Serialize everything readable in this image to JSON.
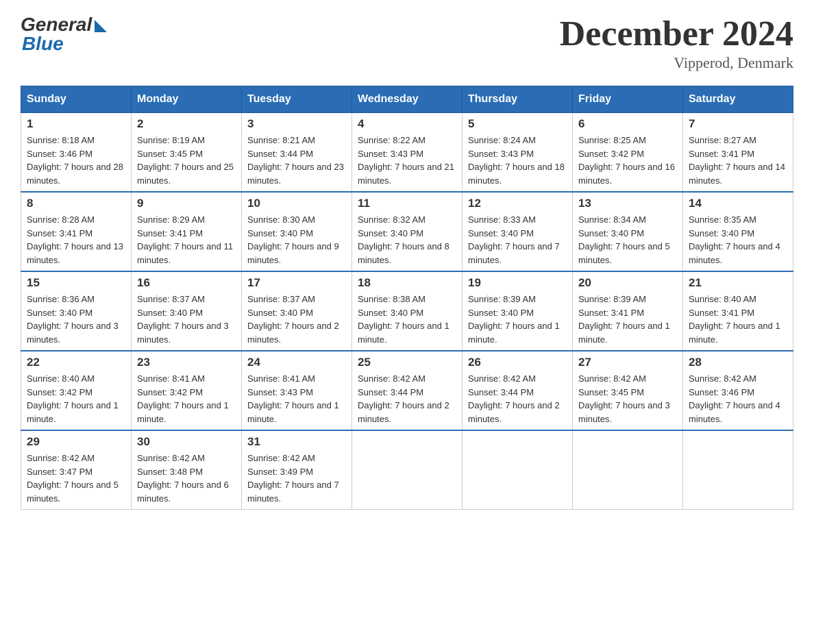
{
  "logo": {
    "general": "General",
    "blue": "Blue"
  },
  "title": "December 2024",
  "location": "Vipperod, Denmark",
  "days_of_week": [
    "Sunday",
    "Monday",
    "Tuesday",
    "Wednesday",
    "Thursday",
    "Friday",
    "Saturday"
  ],
  "weeks": [
    [
      {
        "day": "1",
        "sunrise": "8:18 AM",
        "sunset": "3:46 PM",
        "daylight": "7 hours and 28 minutes."
      },
      {
        "day": "2",
        "sunrise": "8:19 AM",
        "sunset": "3:45 PM",
        "daylight": "7 hours and 25 minutes."
      },
      {
        "day": "3",
        "sunrise": "8:21 AM",
        "sunset": "3:44 PM",
        "daylight": "7 hours and 23 minutes."
      },
      {
        "day": "4",
        "sunrise": "8:22 AM",
        "sunset": "3:43 PM",
        "daylight": "7 hours and 21 minutes."
      },
      {
        "day": "5",
        "sunrise": "8:24 AM",
        "sunset": "3:43 PM",
        "daylight": "7 hours and 18 minutes."
      },
      {
        "day": "6",
        "sunrise": "8:25 AM",
        "sunset": "3:42 PM",
        "daylight": "7 hours and 16 minutes."
      },
      {
        "day": "7",
        "sunrise": "8:27 AM",
        "sunset": "3:41 PM",
        "daylight": "7 hours and 14 minutes."
      }
    ],
    [
      {
        "day": "8",
        "sunrise": "8:28 AM",
        "sunset": "3:41 PM",
        "daylight": "7 hours and 13 minutes."
      },
      {
        "day": "9",
        "sunrise": "8:29 AM",
        "sunset": "3:41 PM",
        "daylight": "7 hours and 11 minutes."
      },
      {
        "day": "10",
        "sunrise": "8:30 AM",
        "sunset": "3:40 PM",
        "daylight": "7 hours and 9 minutes."
      },
      {
        "day": "11",
        "sunrise": "8:32 AM",
        "sunset": "3:40 PM",
        "daylight": "7 hours and 8 minutes."
      },
      {
        "day": "12",
        "sunrise": "8:33 AM",
        "sunset": "3:40 PM",
        "daylight": "7 hours and 7 minutes."
      },
      {
        "day": "13",
        "sunrise": "8:34 AM",
        "sunset": "3:40 PM",
        "daylight": "7 hours and 5 minutes."
      },
      {
        "day": "14",
        "sunrise": "8:35 AM",
        "sunset": "3:40 PM",
        "daylight": "7 hours and 4 minutes."
      }
    ],
    [
      {
        "day": "15",
        "sunrise": "8:36 AM",
        "sunset": "3:40 PM",
        "daylight": "7 hours and 3 minutes."
      },
      {
        "day": "16",
        "sunrise": "8:37 AM",
        "sunset": "3:40 PM",
        "daylight": "7 hours and 3 minutes."
      },
      {
        "day": "17",
        "sunrise": "8:37 AM",
        "sunset": "3:40 PM",
        "daylight": "7 hours and 2 minutes."
      },
      {
        "day": "18",
        "sunrise": "8:38 AM",
        "sunset": "3:40 PM",
        "daylight": "7 hours and 1 minute."
      },
      {
        "day": "19",
        "sunrise": "8:39 AM",
        "sunset": "3:40 PM",
        "daylight": "7 hours and 1 minute."
      },
      {
        "day": "20",
        "sunrise": "8:39 AM",
        "sunset": "3:41 PM",
        "daylight": "7 hours and 1 minute."
      },
      {
        "day": "21",
        "sunrise": "8:40 AM",
        "sunset": "3:41 PM",
        "daylight": "7 hours and 1 minute."
      }
    ],
    [
      {
        "day": "22",
        "sunrise": "8:40 AM",
        "sunset": "3:42 PM",
        "daylight": "7 hours and 1 minute."
      },
      {
        "day": "23",
        "sunrise": "8:41 AM",
        "sunset": "3:42 PM",
        "daylight": "7 hours and 1 minute."
      },
      {
        "day": "24",
        "sunrise": "8:41 AM",
        "sunset": "3:43 PM",
        "daylight": "7 hours and 1 minute."
      },
      {
        "day": "25",
        "sunrise": "8:42 AM",
        "sunset": "3:44 PM",
        "daylight": "7 hours and 2 minutes."
      },
      {
        "day": "26",
        "sunrise": "8:42 AM",
        "sunset": "3:44 PM",
        "daylight": "7 hours and 2 minutes."
      },
      {
        "day": "27",
        "sunrise": "8:42 AM",
        "sunset": "3:45 PM",
        "daylight": "7 hours and 3 minutes."
      },
      {
        "day": "28",
        "sunrise": "8:42 AM",
        "sunset": "3:46 PM",
        "daylight": "7 hours and 4 minutes."
      }
    ],
    [
      {
        "day": "29",
        "sunrise": "8:42 AM",
        "sunset": "3:47 PM",
        "daylight": "7 hours and 5 minutes."
      },
      {
        "day": "30",
        "sunrise": "8:42 AM",
        "sunset": "3:48 PM",
        "daylight": "7 hours and 6 minutes."
      },
      {
        "day": "31",
        "sunrise": "8:42 AM",
        "sunset": "3:49 PM",
        "daylight": "7 hours and 7 minutes."
      },
      null,
      null,
      null,
      null
    ]
  ]
}
